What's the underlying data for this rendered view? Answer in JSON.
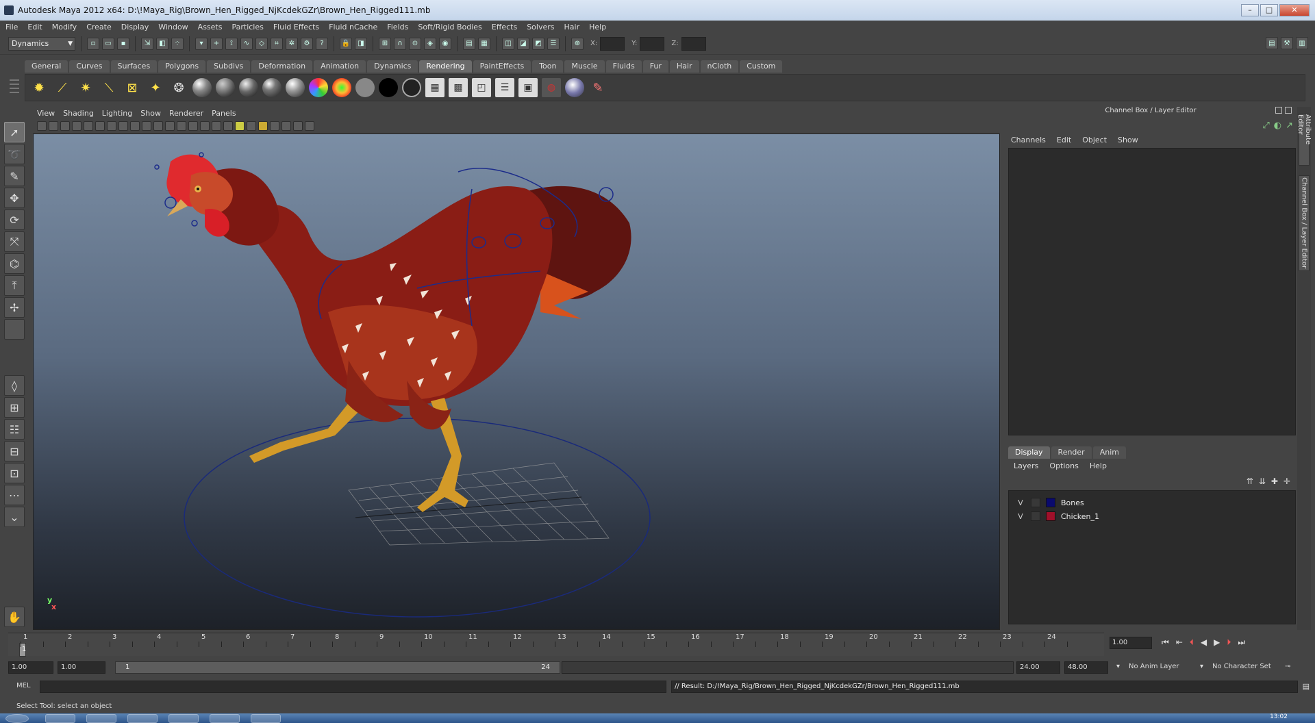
{
  "window": {
    "title": "Autodesk Maya 2012 x64: D:\\!Maya_Rig\\Brown_Hen_Rigged_NjKcdekGZr\\Brown_Hen_Rigged111.mb"
  },
  "menubar": [
    "File",
    "Edit",
    "Modify",
    "Create",
    "Display",
    "Window",
    "Assets",
    "Particles",
    "Fluid Effects",
    "Fluid nCache",
    "Fields",
    "Soft/Rigid Bodies",
    "Effects",
    "Solvers",
    "Hair",
    "Help"
  ],
  "statusline": {
    "menuset": "Dynamics",
    "x_label": "X:",
    "y_label": "Y:",
    "z_label": "Z:"
  },
  "shelf": {
    "tabs": [
      "General",
      "Curves",
      "Surfaces",
      "Polygons",
      "Subdivs",
      "Deformation",
      "Animation",
      "Dynamics",
      "Rendering",
      "PaintEffects",
      "Toon",
      "Muscle",
      "Fluids",
      "Fur",
      "Hair",
      "nCloth",
      "Custom"
    ],
    "active_tab": "Rendering",
    "icons": [
      "ambient-light-icon",
      "directional-light-icon",
      "point-light-icon",
      "spot-light-icon",
      "area-light-icon",
      "volume-light-icon",
      "hypershade-icon",
      "blinn-icon",
      "lambert-icon",
      "phong-icon",
      "phonge-icon",
      "anisotropic-icon",
      "layered-icon",
      "ramp-icon",
      "gray-shader-icon",
      "black-shader-icon",
      "surface-shader-icon",
      "render-view-icon",
      "render-current-icon",
      "ipr-render-icon",
      "render-settings-icon",
      "batch-render-icon",
      "mental-ray-icon",
      "paint-icon"
    ]
  },
  "toolbox": [
    "select-tool-icon",
    "lasso-tool-icon",
    "paint-select-icon",
    "move-tool-icon",
    "rotate-tool-icon",
    "scale-tool-icon",
    "manipulator-icon",
    "soft-mod-icon",
    "show-manipulator-icon",
    "last-tool-icon",
    "single-perspective-icon",
    "four-view-icon",
    "outliner-layout-icon",
    "graph-editor-layout-icon",
    "hypershade-layout-icon",
    "trax-layout-icon",
    "more-layouts-icon",
    "script-editor-icon"
  ],
  "viewport": {
    "menu": [
      "View",
      "Shading",
      "Lighting",
      "Show",
      "Renderer",
      "Panels"
    ],
    "axis_y": "y",
    "axis_x": "x"
  },
  "channelbox": {
    "title": "Channel Box / Layer Editor",
    "menu": [
      "Channels",
      "Edit",
      "Object",
      "Show"
    ]
  },
  "sidetabs": [
    "Attribute Editor",
    "Channel Box / Layer Editor"
  ],
  "layers": {
    "tabs": [
      "Display",
      "Render",
      "Anim"
    ],
    "active_tab": "Display",
    "menu": [
      "Layers",
      "Options",
      "Help"
    ],
    "items": [
      {
        "visible": "V",
        "name": "Bones",
        "color": "#0a0a6e"
      },
      {
        "visible": "V",
        "name": "Chicken_1",
        "color": "#a0102a"
      }
    ]
  },
  "timeline": {
    "ticks": [
      "1",
      "2",
      "3",
      "4",
      "5",
      "6",
      "7",
      "8",
      "9",
      "10",
      "11",
      "12",
      "13",
      "14",
      "15",
      "16",
      "17",
      "18",
      "19",
      "20",
      "21",
      "22",
      "23",
      "24"
    ],
    "current_frame": "1",
    "current_time": "1.00"
  },
  "range": {
    "start_time": "1.00",
    "playback_start": "1.00",
    "range_lo": "1",
    "range_hi": "24",
    "playback_end": "24.00",
    "end_time": "48.00",
    "anim_layer": "No Anim Layer",
    "character_set": "No Character Set"
  },
  "command": {
    "mel_label": "MEL",
    "result": "// Result: D:/!Maya_Rig/Brown_Hen_Rigged_NjKcdekGZr/Brown_Hen_Rigged111.mb"
  },
  "helpline": "Select Tool: select an object",
  "taskbar": {
    "clock": "13:02"
  }
}
